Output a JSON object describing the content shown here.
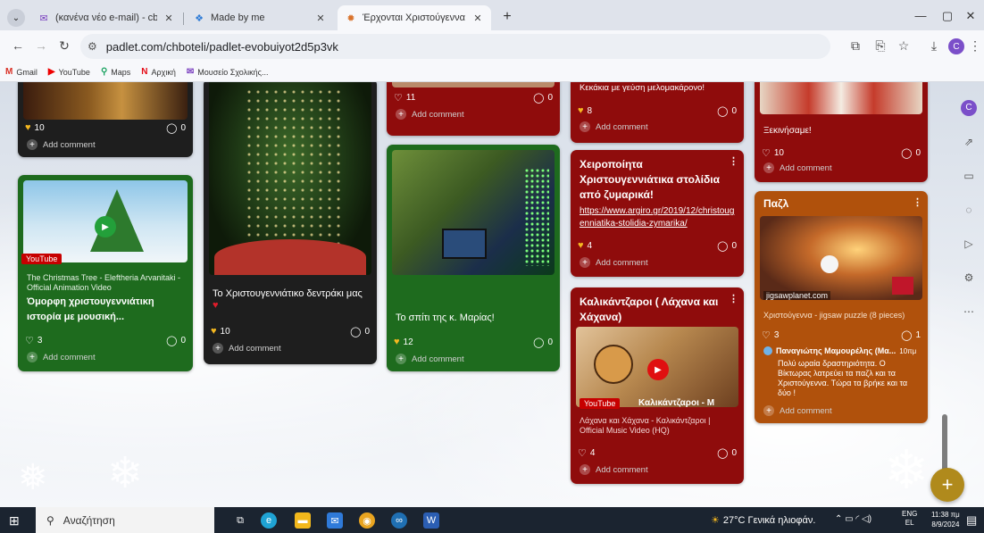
{
  "browser": {
    "tabs": [
      {
        "title": "(κανένα νέο e-mail) - cbnip@y...",
        "icon": "gmail-icon"
      },
      {
        "title": "Made by me",
        "icon": "padlet-icon"
      },
      {
        "title": "Έρχονται Χριστούγεννα!",
        "icon": "padlet-icon"
      }
    ],
    "url": "padlet.com/chboteli/padlet-evobuiyot2d5p3vk",
    "profile_initial": "C",
    "bookmarks": [
      "Gmail",
      "YouTube",
      "Maps",
      "Αρχική",
      "Μουσείο Σχολικής..."
    ]
  },
  "padlet": {
    "col1": {
      "card_top": {
        "likes": "10",
        "comments": "0",
        "add_comment": "Add comment"
      },
      "card_video": {
        "badge": "YouTube",
        "video_caption": "The Christmas Tree - Eleftheria Arvanitaki - Official Animation Video",
        "title": "Όμορφη χριστουγεννιάτικη ιστορία με μουσική...",
        "likes": "3",
        "comments": "0",
        "add_comment": "Add comment"
      }
    },
    "col2": {
      "card_tree": {
        "title": "Το Χριστουγεννιάτικο δεντράκι μας",
        "likes": "10",
        "comments": "0",
        "add_comment": "Add comment"
      }
    },
    "col3": {
      "card_top": {
        "likes": "11",
        "comments": "0",
        "add_comment": "Add comment"
      },
      "card_house": {
        "title": "Το σπίτι της κ. Μαρίας!",
        "likes": "12",
        "comments": "0",
        "add_comment": "Add comment"
      }
    },
    "col4": {
      "card_top": {
        "title": "Κεκάκια με γεύση μελομακάρονο!",
        "likes": "8",
        "comments": "0",
        "add_comment": "Add comment"
      },
      "card_handmade": {
        "title": "Χειροποίητα Χριστουγεννιάτικα στολίδια από ζυμαρικά!",
        "link": "https://www.argiro.gr/2019/12/christougenniatika-stolidia-zymarika/",
        "likes": "4",
        "comments": "0",
        "add_comment": "Add comment"
      },
      "card_cabbage": {
        "title": "Καλικάντζαροι ( Λάχανα και Χάχανα)",
        "badge": "YouTube",
        "video_overlay": "Καλικάντζαροι - Μ",
        "video_caption": "Λάχανα και Χάχανα - Καλικάντζαροι | Official Music Video (HQ)",
        "likes": "4",
        "comments": "0",
        "add_comment": "Add comment"
      }
    },
    "col5": {
      "card_top": {
        "title": "Ξεκινήσαμε!",
        "likes": "10",
        "comments": "0",
        "add_comment": "Add comment"
      },
      "card_puzzle": {
        "title": "Παζλ",
        "source": "jigsawplanet.com",
        "caption": "Χριστούγεννα - jigsaw puzzle (8 pieces)",
        "likes": "3",
        "comments": "1",
        "commenter": "Παναγιώτης Μαμουρέλης (Μα...",
        "comment_time": "10πμ",
        "comment_text": "Πολύ ωραία δραστηριότητα. Ο Βίκτωρας λατρεύει τα παζλ και τα Χριστούγεννα. Τώρα τα βρήκε και τα δύο !",
        "add_comment": "Add comment"
      }
    },
    "fab_label": "+"
  },
  "taskbar": {
    "search_placeholder": "Αναζήτηση",
    "weather": "27°C Γενικά ηλιοφάν.",
    "lang1": "ENG",
    "lang2": "EL",
    "time": "11:38 πμ",
    "date": "8/9/2024"
  }
}
